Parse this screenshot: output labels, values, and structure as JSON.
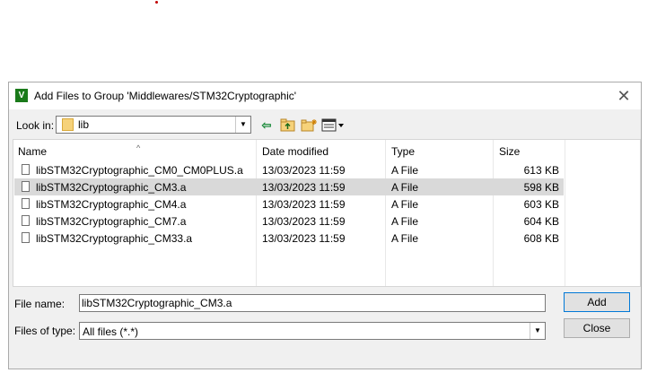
{
  "window": {
    "title": "Add Files to Group 'Middlewares/STM32Cryptographic'",
    "app_icon": "V"
  },
  "lookin": {
    "label": "Look in:",
    "value": "lib"
  },
  "toolbar": {
    "icons": [
      "back-arrow-icon",
      "up-folder-icon",
      "new-folder-icon",
      "view-menu-icon"
    ]
  },
  "columns": {
    "name": "Name",
    "date": "Date modified",
    "type": "Type",
    "size": "Size"
  },
  "files": [
    {
      "name": "libSTM32Cryptographic_CM0_CM0PLUS.a",
      "date": "13/03/2023 11:59",
      "type": "A File",
      "size": "613 KB",
      "selected": false
    },
    {
      "name": "libSTM32Cryptographic_CM3.a",
      "date": "13/03/2023 11:59",
      "type": "A File",
      "size": "598 KB",
      "selected": true
    },
    {
      "name": "libSTM32Cryptographic_CM4.a",
      "date": "13/03/2023 11:59",
      "type": "A File",
      "size": "603 KB",
      "selected": false
    },
    {
      "name": "libSTM32Cryptographic_CM7.a",
      "date": "13/03/2023 11:59",
      "type": "A File",
      "size": "604 KB",
      "selected": false
    },
    {
      "name": "libSTM32Cryptographic_CM33.a",
      "date": "13/03/2023 11:59",
      "type": "A File",
      "size": "608 KB",
      "selected": false
    }
  ],
  "filename": {
    "label": "File name:",
    "value": "libSTM32Cryptographic_CM3.a"
  },
  "filetype": {
    "label": "Files of type:",
    "value": "All files (*.*)"
  },
  "buttons": {
    "add": "Add",
    "close": "Close"
  },
  "colors": {
    "selection": "#d9d9d9",
    "folder": "#f6d27a",
    "accent": "#0078d7"
  }
}
